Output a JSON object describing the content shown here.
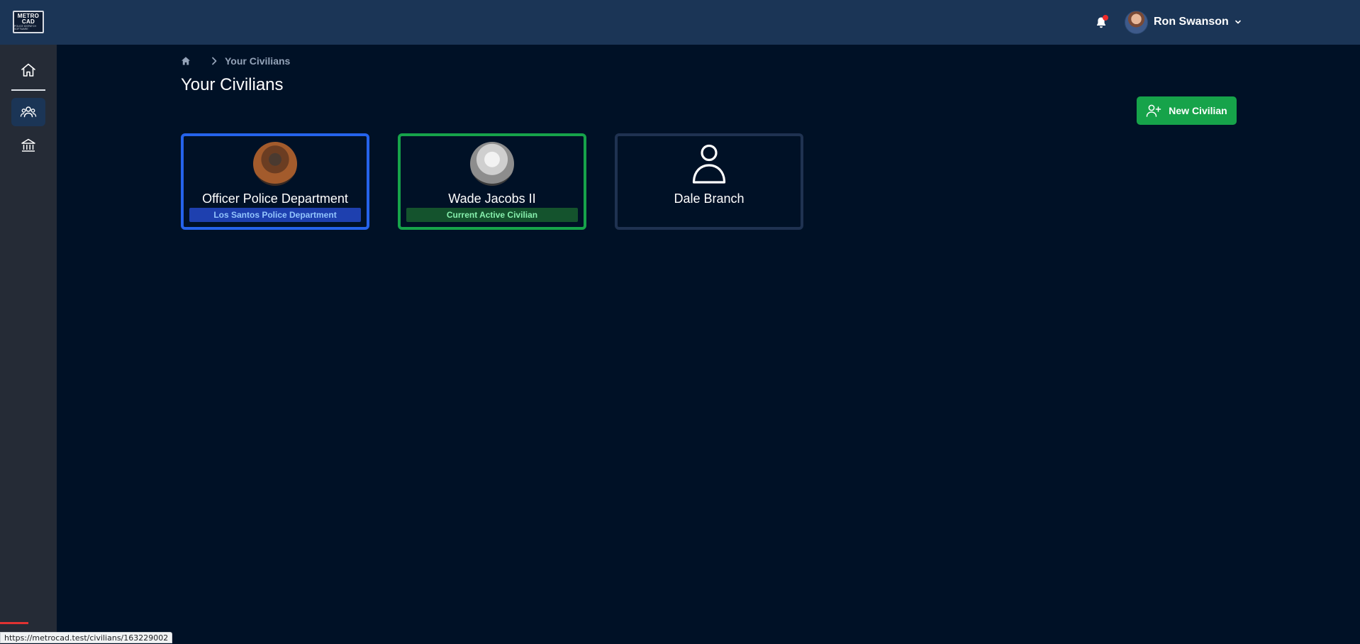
{
  "header": {
    "logo": {
      "line1": "METRO",
      "line2": "CAD",
      "tagline": "POLICE DISPATCH SOFTWARE"
    },
    "notification_icon": "bell-icon",
    "user": {
      "name": "Ron Swanson",
      "avatar_icon": "avatar"
    }
  },
  "sidebar": {
    "items": [
      {
        "label": "Home",
        "icon": "home-icon"
      },
      {
        "label": "Civilians",
        "icon": "users-icon",
        "active": true
      },
      {
        "label": "Departments",
        "icon": "bank-icon"
      }
    ]
  },
  "breadcrumb": {
    "home_icon": "home-icon",
    "current": "Your Civilians"
  },
  "page": {
    "title": "Your Civilians",
    "new_button_label": "New Civilian"
  },
  "civilians": [
    {
      "name": "Officer Police Department",
      "badge": "Los Santos Police Department",
      "style": "blue",
      "has_photo": true
    },
    {
      "name": "Wade Jacobs II",
      "badge": "Current Active Civilian",
      "style": "green",
      "has_photo": true
    },
    {
      "name": "Dale Branch",
      "badge": "",
      "style": "default",
      "has_photo": false
    }
  ],
  "status_bar": {
    "url": "https://metrocad.test/civilians/163229002"
  },
  "colors": {
    "background": "#001126",
    "topbar": "#1b3556",
    "sidebar": "#252b36",
    "primary_green": "#16a34a",
    "primary_blue": "#2563eb"
  }
}
